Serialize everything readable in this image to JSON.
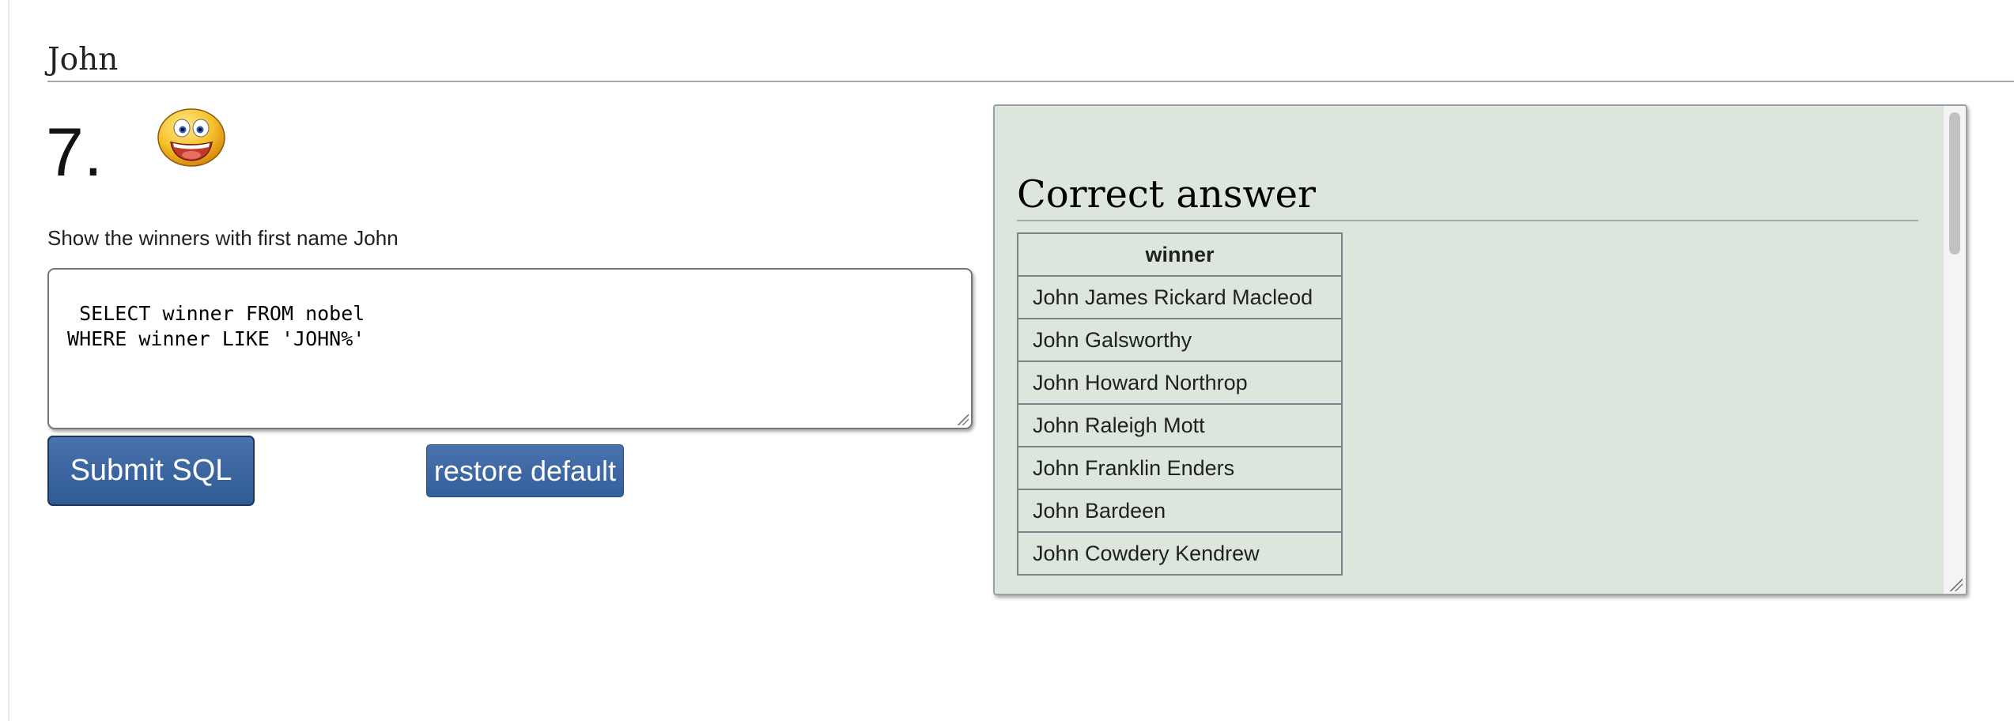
{
  "page": {
    "section_title": "John",
    "question_number": "7.",
    "question_text": "Show the winners with first name John"
  },
  "editor": {
    "sql": "SELECT winner FROM nobel\n WHERE winner LIKE 'JOHN%'"
  },
  "buttons": {
    "submit_label": "Submit SQL",
    "restore_label": "restore default"
  },
  "answer": {
    "heading": "Correct answer",
    "column_header": "winner",
    "rows": [
      "John James Rickard Macleod",
      "John Galsworthy",
      "John Howard Northrop",
      "John Raleigh Mott",
      "John Franklin Enders",
      "John Bardeen",
      "John Cowdery Kendrew"
    ]
  },
  "icons": {
    "status": "smiley-face-icon"
  },
  "colors": {
    "button_blue": "#2f5a94",
    "answer_background": "#dde6dc"
  }
}
